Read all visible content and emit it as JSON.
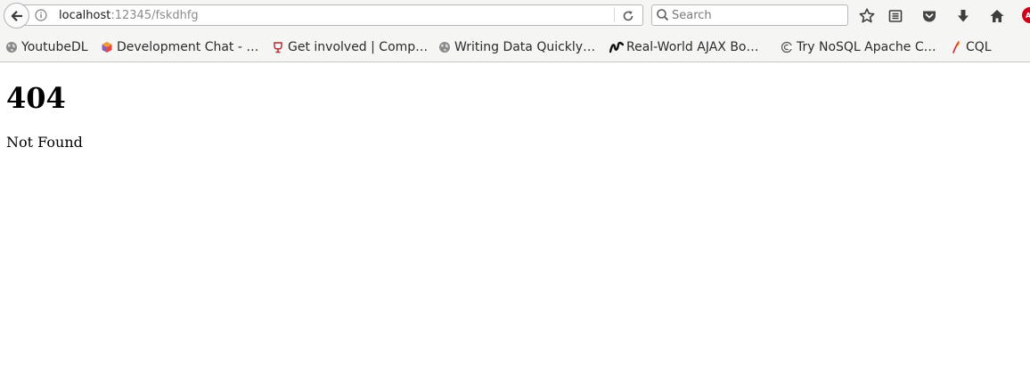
{
  "browser": {
    "url": {
      "host": "localhost",
      "rest": ":12345/fskdhfg"
    },
    "search": {
      "placeholder": "Search"
    },
    "adblock_badge": "AB",
    "bookmarks": [
      {
        "label": "YoutubeDL",
        "icon": "globe-icon"
      },
      {
        "label": "Development Chat - …",
        "icon": "hexagon-icon"
      },
      {
        "label": "Get involved | Comp…",
        "icon": "chalice-icon"
      },
      {
        "label": "Writing Data Quickly…",
        "icon": "globe-icon"
      },
      {
        "label": "Real-World AJAX Bo…",
        "icon": "infoq-icon"
      },
      {
        "label": "Try NoSQL Apache C…",
        "icon": "couchdb-icon"
      },
      {
        "label": "CQL",
        "icon": "feather-icon"
      }
    ]
  },
  "page": {
    "heading": "404",
    "message": "Not Found"
  }
}
